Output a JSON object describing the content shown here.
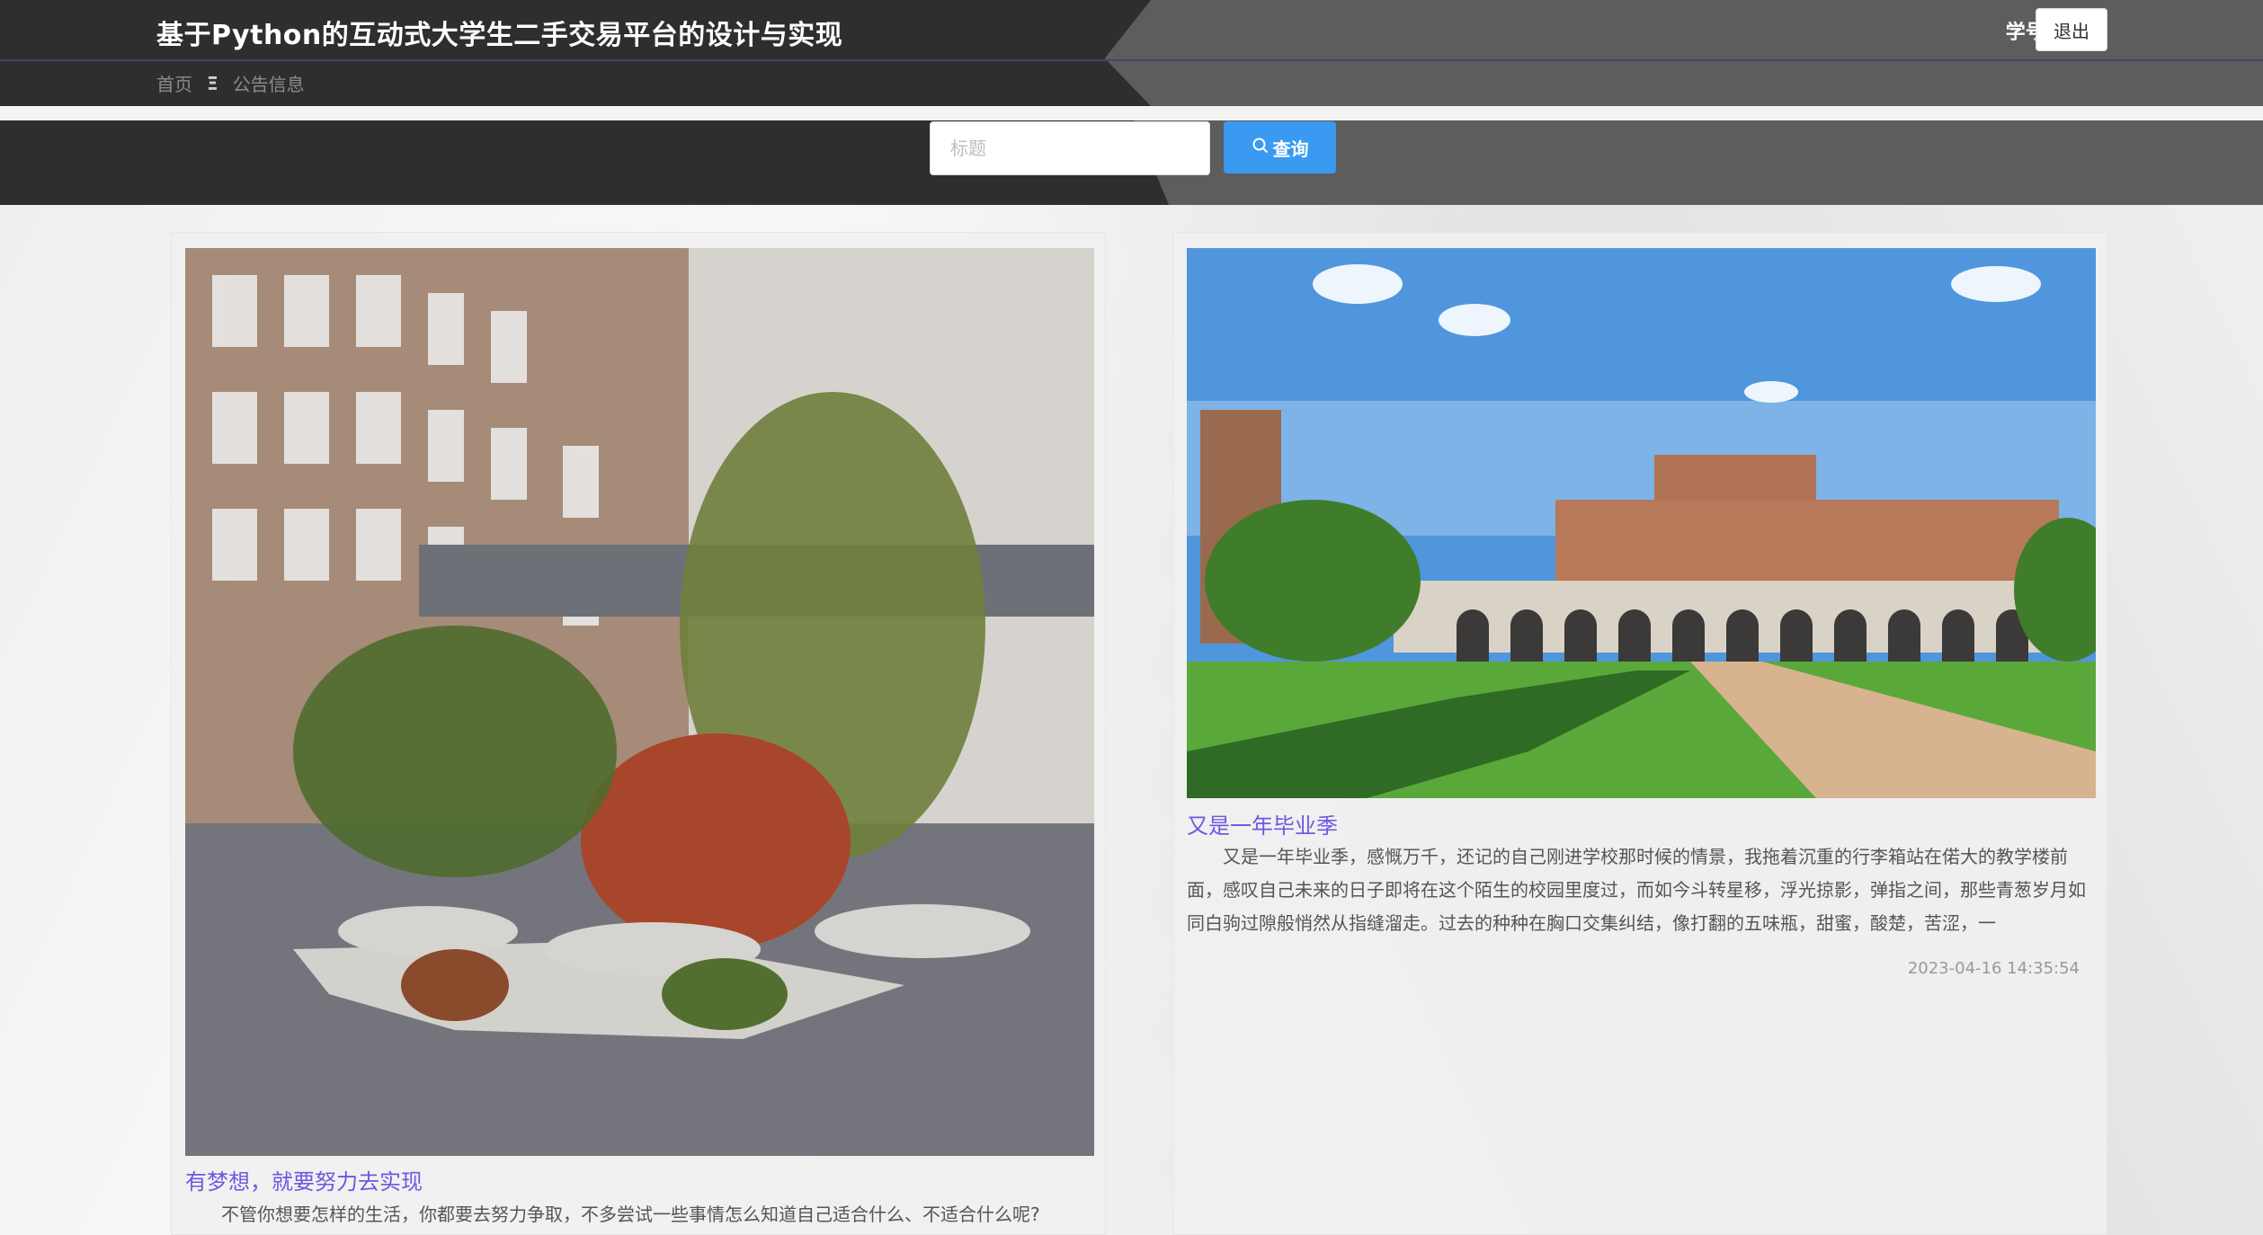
{
  "header": {
    "title": "基于Python的互动式大学生二手交易平台的设计与实现",
    "user_label": "学号1",
    "logout_label": "退出"
  },
  "breadcrumb": {
    "home": "首页",
    "separator": "Ξ",
    "current": "公告信息"
  },
  "search": {
    "placeholder": "标题",
    "value": "",
    "button_label": "查询",
    "button_icon": "search-icon"
  },
  "colors": {
    "search_button": "#3a99f0",
    "card_title": "#6b5ae0",
    "header_dark": "#2e2e2e",
    "header_light": "#5d5d5d"
  },
  "announcements": [
    {
      "image": "campus-courtyard-photo",
      "title": "有梦想，就要努力去实现",
      "excerpt": "不管你想要怎样的生活，你都要去努力争取，不多尝试一些事情怎么知道自己适合什么、不适合什么呢?",
      "date": ""
    },
    {
      "image": "university-building-lawn-photo",
      "title": "又是一年毕业季",
      "excerpt": "又是一年毕业季，感慨万千，还记的自己刚进学校那时候的情景，我拖着沉重的行李箱站在偌大的教学楼前面，感叹自己未来的日子即将在这个陌生的校园里度过，而如今斗转星移，浮光掠影，弹指之间，那些青葱岁月如同白驹过隙般悄然从指缝溜走。过去的种种在胸口交集纠结，像打翻的五味瓶，甜蜜，酸楚，苦涩，一",
      "date": "2023-04-16 14:35:54"
    }
  ]
}
